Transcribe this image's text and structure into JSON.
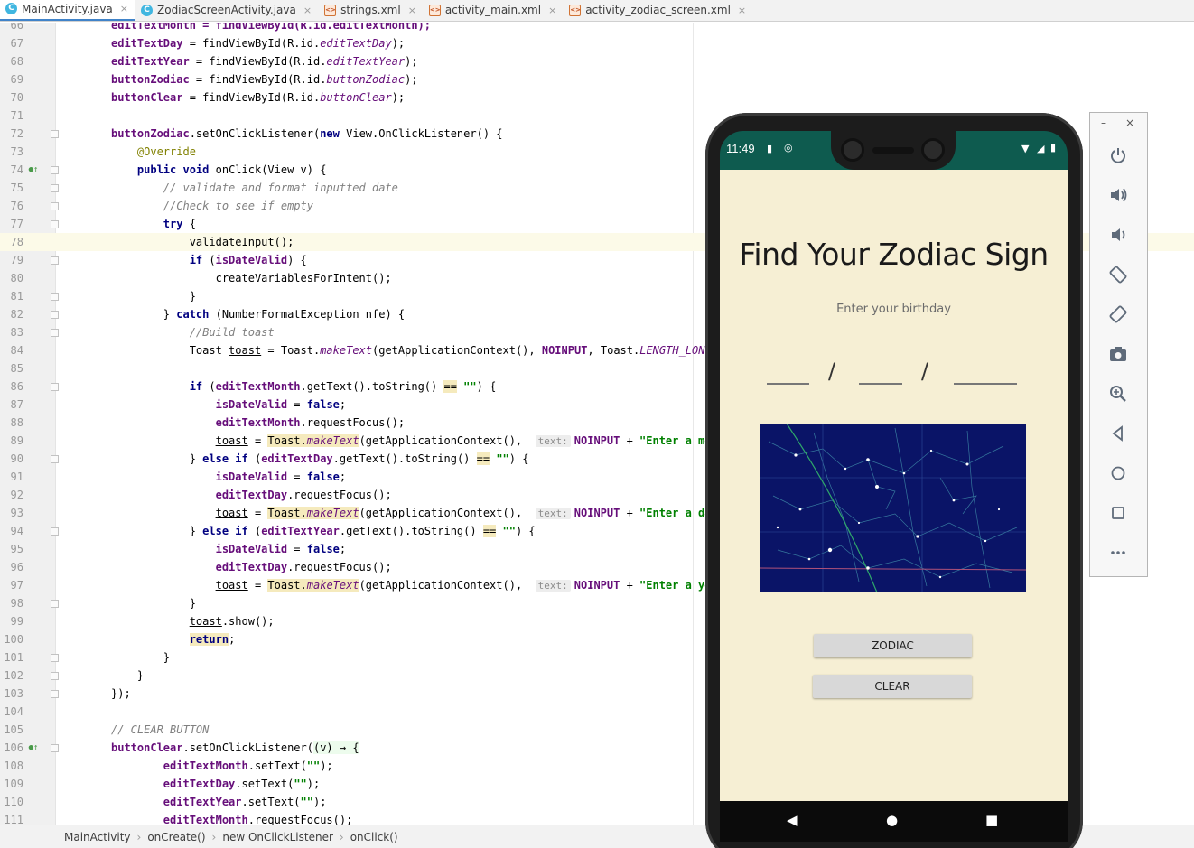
{
  "tabs": [
    {
      "label": "MainActivity.java",
      "type": "java",
      "active": true
    },
    {
      "label": "ZodiacScreenActivity.java",
      "type": "java",
      "active": false
    },
    {
      "label": "strings.xml",
      "type": "xml",
      "active": false
    },
    {
      "label": "activity_main.xml",
      "type": "xml",
      "active": false
    },
    {
      "label": "activity_zodiac_screen.xml",
      "type": "xml",
      "active": false
    }
  ],
  "tab_close_glyph": "×",
  "editor": {
    "current_line": "78",
    "lines": [
      {
        "n": "66",
        "tokens": [
          {
            "t": "editTextMonth = findViewById(R.id.editTextMonth);",
            "c": "fld"
          }
        ]
      },
      {
        "n": "67",
        "tokens": [
          {
            "t": "editTextDay",
            "c": "fld"
          },
          {
            "t": " = findViewById(R.id."
          },
          {
            "t": "editTextDay",
            "c": "st"
          },
          {
            "t": ");"
          }
        ]
      },
      {
        "n": "68",
        "tokens": [
          {
            "t": "editTextYear",
            "c": "fld"
          },
          {
            "t": " = findViewById(R.id."
          },
          {
            "t": "editTextYear",
            "c": "st"
          },
          {
            "t": ");"
          }
        ]
      },
      {
        "n": "69",
        "tokens": [
          {
            "t": "buttonZodiac",
            "c": "fld"
          },
          {
            "t": " = findViewById(R.id."
          },
          {
            "t": "buttonZodiac",
            "c": "st"
          },
          {
            "t": ");"
          }
        ]
      },
      {
        "n": "70",
        "tokens": [
          {
            "t": "buttonClear",
            "c": "fld"
          },
          {
            "t": " = findViewById(R.id."
          },
          {
            "t": "buttonClear",
            "c": "st"
          },
          {
            "t": ");"
          }
        ]
      },
      {
        "n": "71",
        "tokens": []
      },
      {
        "n": "72",
        "tokens": [
          {
            "t": "buttonZodiac",
            "c": "fld"
          },
          {
            "t": ".setOnClickListener("
          },
          {
            "t": "new",
            "c": "kw"
          },
          {
            "t": " View.OnClickListener() {"
          }
        ]
      },
      {
        "n": "73",
        "tokens": [
          {
            "t": "    "
          },
          {
            "t": "@Override",
            "c": "ann"
          }
        ]
      },
      {
        "n": "74",
        "tokens": [
          {
            "t": "    "
          },
          {
            "t": "public void",
            "c": "kw"
          },
          {
            "t": " onClick(View v) {"
          }
        ]
      },
      {
        "n": "75",
        "tokens": [
          {
            "t": "        "
          },
          {
            "t": "// validate and format inputted date",
            "c": "cmt"
          }
        ]
      },
      {
        "n": "76",
        "tokens": [
          {
            "t": "        "
          },
          {
            "t": "//Check to see if empty",
            "c": "cmt"
          }
        ]
      },
      {
        "n": "77",
        "tokens": [
          {
            "t": "        "
          },
          {
            "t": "try",
            "c": "kw"
          },
          {
            "t": " {"
          }
        ]
      },
      {
        "n": "78",
        "tokens": [
          {
            "t": "            validateInput();"
          }
        ]
      },
      {
        "n": "79",
        "tokens": [
          {
            "t": "            "
          },
          {
            "t": "if",
            "c": "kw"
          },
          {
            "t": " ("
          },
          {
            "t": "isDateValid",
            "c": "fld"
          },
          {
            "t": ") {"
          }
        ]
      },
      {
        "n": "80",
        "tokens": [
          {
            "t": "                createVariablesForIntent();"
          }
        ]
      },
      {
        "n": "81",
        "tokens": [
          {
            "t": "            }"
          }
        ]
      },
      {
        "n": "82",
        "tokens": [
          {
            "t": "        } "
          },
          {
            "t": "catch",
            "c": "kw"
          },
          {
            "t": " (NumberFormatException nfe) {"
          }
        ]
      },
      {
        "n": "83",
        "tokens": [
          {
            "t": "            "
          },
          {
            "t": "//Build toast",
            "c": "cmt"
          }
        ]
      },
      {
        "n": "84",
        "tokens": [
          {
            "t": "            Toast "
          },
          {
            "t": "toast",
            "c": "und"
          },
          {
            "t": " = Toast."
          },
          {
            "t": "makeText",
            "c": "st"
          },
          {
            "t": "(getApplicationContext(), "
          },
          {
            "t": "NOINPUT",
            "c": "fld"
          },
          {
            "t": ", Toast."
          },
          {
            "t": "LENGTH_LONG",
            "c": "st"
          },
          {
            "t": ");"
          }
        ]
      },
      {
        "n": "85",
        "tokens": []
      },
      {
        "n": "86",
        "tokens": [
          {
            "t": "            "
          },
          {
            "t": "if",
            "c": "kw"
          },
          {
            "t": " ("
          },
          {
            "t": "editTextMonth",
            "c": "fld"
          },
          {
            "t": ".getText().toString() "
          },
          {
            "t": "==",
            "c": "hl"
          },
          {
            "t": " "
          },
          {
            "t": "\"\"",
            "c": "strg"
          },
          {
            "t": ") {"
          }
        ]
      },
      {
        "n": "87",
        "tokens": [
          {
            "t": "                "
          },
          {
            "t": "isDateValid",
            "c": "fld"
          },
          {
            "t": " = "
          },
          {
            "t": "false",
            "c": "kw"
          },
          {
            "t": ";"
          }
        ]
      },
      {
        "n": "88",
        "tokens": [
          {
            "t": "                "
          },
          {
            "t": "editTextMonth",
            "c": "fld"
          },
          {
            "t": ".requestFocus();"
          }
        ]
      },
      {
        "n": "89",
        "tokens": [
          {
            "t": "                "
          },
          {
            "t": "toast",
            "c": "und"
          },
          {
            "t": " = "
          },
          {
            "t": "Toast.",
            "c": "hl"
          },
          {
            "t": "makeText",
            "c": "st hl"
          },
          {
            "t": "(getApplicationContext(),  "
          },
          {
            "t": "text:",
            "c": "hint"
          },
          {
            "t": "NOINPUT",
            "c": "fld"
          },
          {
            "t": " + "
          },
          {
            "t": "\"Enter a month.\"",
            "c": "strg"
          }
        ]
      },
      {
        "n": "90",
        "tokens": [
          {
            "t": "            } "
          },
          {
            "t": "else if",
            "c": "kw"
          },
          {
            "t": " ("
          },
          {
            "t": "editTextDay",
            "c": "fld"
          },
          {
            "t": ".getText().toString() "
          },
          {
            "t": "==",
            "c": "hl"
          },
          {
            "t": " "
          },
          {
            "t": "\"\"",
            "c": "strg"
          },
          {
            "t": ") {"
          }
        ]
      },
      {
        "n": "91",
        "tokens": [
          {
            "t": "                "
          },
          {
            "t": "isDateValid",
            "c": "fld"
          },
          {
            "t": " = "
          },
          {
            "t": "false",
            "c": "kw"
          },
          {
            "t": ";"
          }
        ]
      },
      {
        "n": "92",
        "tokens": [
          {
            "t": "                "
          },
          {
            "t": "editTextDay",
            "c": "fld"
          },
          {
            "t": ".requestFocus();"
          }
        ]
      },
      {
        "n": "93",
        "tokens": [
          {
            "t": "                "
          },
          {
            "t": "toast",
            "c": "und"
          },
          {
            "t": " = "
          },
          {
            "t": "Toast.",
            "c": "hl"
          },
          {
            "t": "makeText",
            "c": "st hl"
          },
          {
            "t": "(getApplicationContext(),  "
          },
          {
            "t": "text:",
            "c": "hint"
          },
          {
            "t": "NOINPUT",
            "c": "fld"
          },
          {
            "t": " + "
          },
          {
            "t": "\"Enter a day.\"",
            "c": "strg"
          },
          {
            "t": ","
          }
        ]
      },
      {
        "n": "94",
        "tokens": [
          {
            "t": "            } "
          },
          {
            "t": "else if",
            "c": "kw"
          },
          {
            "t": " ("
          },
          {
            "t": "editTextYear",
            "c": "fld"
          },
          {
            "t": ".getText().toString() "
          },
          {
            "t": "==",
            "c": "hl"
          },
          {
            "t": " "
          },
          {
            "t": "\"\"",
            "c": "strg"
          },
          {
            "t": ") {"
          }
        ]
      },
      {
        "n": "95",
        "tokens": [
          {
            "t": "                "
          },
          {
            "t": "isDateValid",
            "c": "fld"
          },
          {
            "t": " = "
          },
          {
            "t": "false",
            "c": "kw"
          },
          {
            "t": ";"
          }
        ]
      },
      {
        "n": "96",
        "tokens": [
          {
            "t": "                "
          },
          {
            "t": "editTextDay",
            "c": "fld"
          },
          {
            "t": ".requestFocus();"
          }
        ]
      },
      {
        "n": "97",
        "tokens": [
          {
            "t": "                "
          },
          {
            "t": "toast",
            "c": "und"
          },
          {
            "t": " = "
          },
          {
            "t": "Toast.",
            "c": "hl"
          },
          {
            "t": "makeText",
            "c": "st hl"
          },
          {
            "t": "(getApplicationContext(),  "
          },
          {
            "t": "text:",
            "c": "hint"
          },
          {
            "t": "NOINPUT",
            "c": "fld"
          },
          {
            "t": " + "
          },
          {
            "t": "\"Enter a year.\"",
            "c": "strg"
          }
        ]
      },
      {
        "n": "98",
        "tokens": [
          {
            "t": "            }"
          }
        ]
      },
      {
        "n": "99",
        "tokens": [
          {
            "t": "            "
          },
          {
            "t": "toast",
            "c": "und"
          },
          {
            "t": ".show();"
          }
        ]
      },
      {
        "n": "100",
        "tokens": [
          {
            "t": "            "
          },
          {
            "t": "return",
            "c": "kw hl"
          },
          {
            "t": ";"
          }
        ]
      },
      {
        "n": "101",
        "tokens": [
          {
            "t": "        }"
          }
        ]
      },
      {
        "n": "102",
        "tokens": [
          {
            "t": "    }"
          }
        ]
      },
      {
        "n": "103",
        "tokens": [
          {
            "t": "});"
          }
        ]
      },
      {
        "n": "104",
        "tokens": []
      },
      {
        "n": "105",
        "tokens": [
          {
            "t": "// CLEAR BUTTON",
            "c": "cmt"
          }
        ]
      },
      {
        "n": "106",
        "tokens": [
          {
            "t": "buttonClear",
            "c": "fld"
          },
          {
            "t": ".setOnClickListener("
          },
          {
            "t": "(v) → {",
            "c": "lam"
          }
        ]
      },
      {
        "n": "108",
        "tokens": [
          {
            "t": "        "
          },
          {
            "t": "editTextMonth",
            "c": "fld"
          },
          {
            "t": ".setText("
          },
          {
            "t": "\"\"",
            "c": "strg"
          },
          {
            "t": ");"
          }
        ]
      },
      {
        "n": "109",
        "tokens": [
          {
            "t": "        "
          },
          {
            "t": "editTextDay",
            "c": "fld"
          },
          {
            "t": ".setText("
          },
          {
            "t": "\"\"",
            "c": "strg"
          },
          {
            "t": ");"
          }
        ]
      },
      {
        "n": "110",
        "tokens": [
          {
            "t": "        "
          },
          {
            "t": "editTextYear",
            "c": "fld"
          },
          {
            "t": ".setText("
          },
          {
            "t": "\"\"",
            "c": "strg"
          },
          {
            "t": ");"
          }
        ]
      },
      {
        "n": "111",
        "tokens": [
          {
            "t": "        "
          },
          {
            "t": "editTextMonth",
            "c": "fld"
          },
          {
            "t": ".requestFocus();"
          }
        ]
      }
    ]
  },
  "breadcrumb": [
    "MainActivity",
    "onCreate()",
    "new OnClickListener",
    "onClick()"
  ],
  "breadcrumb_separator": "›",
  "emulator": {
    "status_time": "11:49",
    "app_title": "Find Your Zodiac Sign",
    "subtitle": "Enter your birthday",
    "date_separator": "/",
    "zodiac_button": "ZODIAC",
    "clear_button": "CLEAR",
    "image_icon": "star-map-image",
    "nav_icons": [
      "back-icon",
      "home-icon",
      "recents-icon"
    ]
  },
  "emulator_toolbar": {
    "minimize_glyph": "–",
    "close_glyph": "×",
    "buttons": [
      "power-icon",
      "volume-up-icon",
      "volume-down-icon",
      "rotate-left-icon",
      "rotate-right-icon",
      "camera-icon",
      "zoom-icon",
      "back-icon",
      "home-icon",
      "overview-icon",
      "more-icon"
    ]
  },
  "colors": {
    "status_bar": "#0e5b4f",
    "app_background": "#f6efd4",
    "star_map": "#0a1467",
    "current_line": "#fcfae8"
  }
}
